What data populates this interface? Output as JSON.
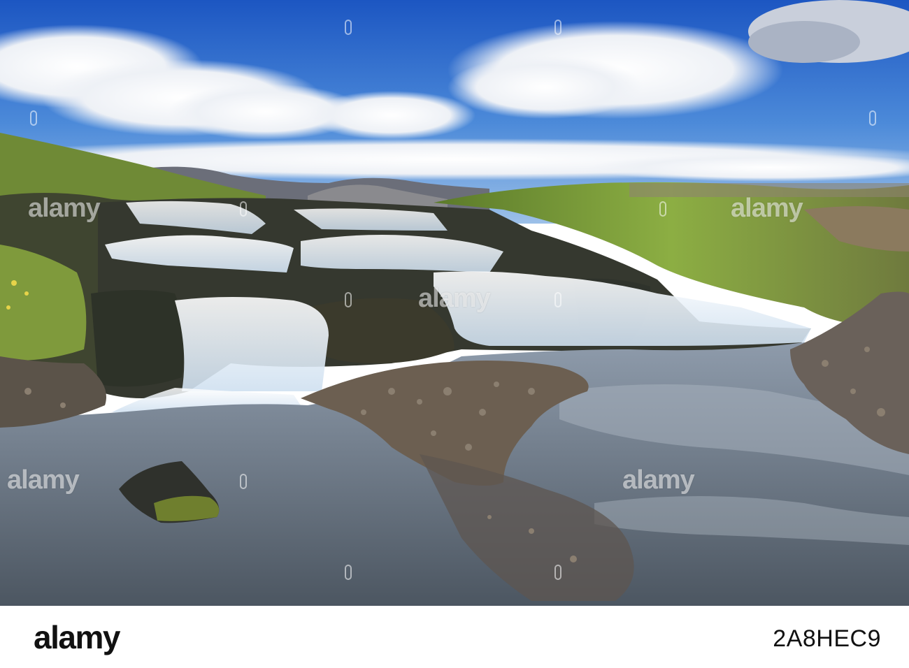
{
  "photo": {
    "colors": {
      "sky_top": "#1f5cc8",
      "sky_mid": "#4a86dc",
      "cloud": "#f2f4f8",
      "grass": "#7da03a",
      "rock": "#3a3b34",
      "water": "#9aa7b4",
      "foam": "#eef4fb"
    }
  },
  "watermark": {
    "text": "alamy",
    "color": "#ffffff"
  },
  "footer": {
    "logo": "alamy",
    "image_id": "2A8HEC9"
  }
}
